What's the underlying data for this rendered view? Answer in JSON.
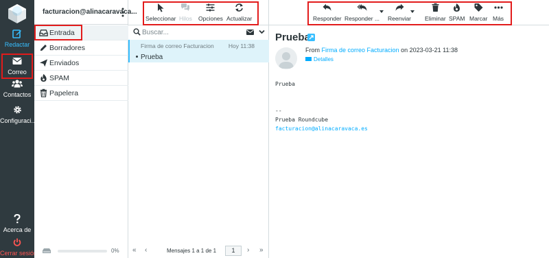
{
  "rail": {
    "compose_label": "Redactar",
    "mail_label": "Correo",
    "contacts_label": "Contactos",
    "settings_label": "Configuraci...",
    "about_label": "Acerca de",
    "logout_label": "Cerrar sesión"
  },
  "folders": {
    "account": "facturacion@alinacaravaca...",
    "items": [
      {
        "label": "Entrada",
        "icon": "inbox-icon",
        "selected": true
      },
      {
        "label": "Borradores",
        "icon": "pencil-icon",
        "selected": false
      },
      {
        "label": "Enviados",
        "icon": "paper-plane-icon",
        "selected": false
      },
      {
        "label": "SPAM",
        "icon": "fire-icon",
        "selected": false
      },
      {
        "label": "Papelera",
        "icon": "trash-icon",
        "selected": false
      }
    ],
    "quota": "0%"
  },
  "list_toolbar": {
    "select": "Seleccionar",
    "threads": "Hilos",
    "options": "Opciones",
    "refresh": "Actualizar"
  },
  "search": {
    "placeholder": "Buscar..."
  },
  "message": {
    "from": "Firma de correo Facturacion",
    "date": "Hoy 11:38",
    "subject": "Prueba"
  },
  "list_footer": {
    "count": "Mensajes 1 a 1 de 1",
    "page": "1"
  },
  "preview_toolbar": {
    "reply": "Responder",
    "reply_all": "Responder ...",
    "forward": "Reenviar",
    "delete": "Eliminar",
    "spam": "SPAM",
    "mark": "Marcar",
    "more": "Más"
  },
  "preview": {
    "subject": "Prueba",
    "from_prefix": "From",
    "sender": "Firma de correo Facturacion",
    "date_text": "on 2023-03-21 11:38",
    "details": "Detalles",
    "body_line1": "Prueba",
    "signature_sep": "--",
    "signature_name": "Prueba Roundcube",
    "signature_email": "facturacion@alinacaravaca.es"
  },
  "colors": {
    "rail_bg": "#2f3a3f",
    "accent": "#37beff",
    "link": "#00acff",
    "logout": "#ff5552",
    "highlight_box": "#e21b1b",
    "selected_row": "#def3fa"
  }
}
